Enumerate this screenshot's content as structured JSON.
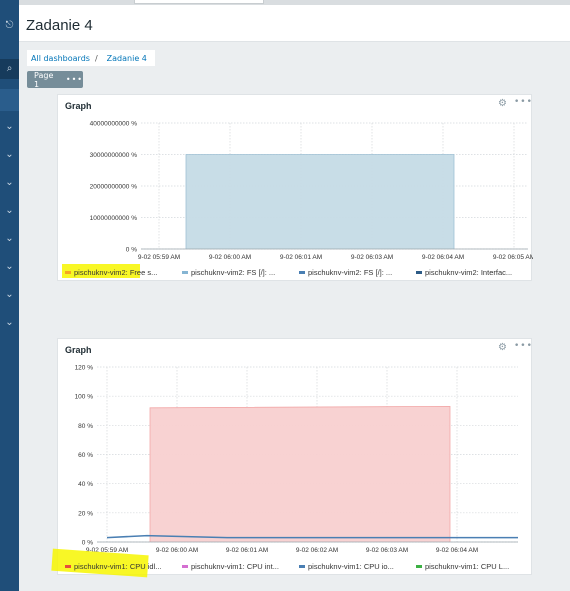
{
  "header": {
    "title": "Zadanie 4"
  },
  "breadcrumb": {
    "root": "All dashboards",
    "separator": "/",
    "current": "Zadanie 4"
  },
  "page_tab": {
    "label": "Page 1",
    "menu": "•••"
  },
  "sidebar": {
    "icons": [
      "logout-icon",
      "search-icon",
      "chevron-down-icon",
      "chevron-down-icon",
      "chevron-down-icon",
      "chevron-down-icon",
      "chevron-down-icon",
      "chevron-down-icon",
      "chevron-down-icon",
      "chevron-down-icon"
    ]
  },
  "highlight_color": "#f7f600",
  "widgets": [
    {
      "title": "Graph",
      "legend": [
        {
          "label": "pischuknv-vim2: Free s...",
          "color": "#f5a623"
        },
        {
          "label": "pischuknv-vim2: FS [/]: ...",
          "color": "#86b5d3"
        },
        {
          "label": "pischuknv-vim2: FS [/]: ...",
          "color": "#4a7fb3"
        },
        {
          "label": "pischuknv-vim2: Interfac...",
          "color": "#2d5b86"
        }
      ]
    },
    {
      "title": "Graph",
      "legend": [
        {
          "label": "pischuknv-vim1: CPU idl...",
          "color": "#e74c3c"
        },
        {
          "label": "pischuknv-vim1: CPU int...",
          "color": "#d46fd1"
        },
        {
          "label": "pischuknv-vim1: CPU io...",
          "color": "#4a7fb3"
        },
        {
          "label": "pischuknv-vim1: CPU L...",
          "color": "#3cb043"
        }
      ]
    }
  ],
  "chart_data": [
    {
      "type": "area",
      "y_ticks": [
        "40000000000 %",
        "30000000000 %",
        "20000000000 %",
        "10000000000 %",
        "0 %"
      ],
      "x_ticks": [
        "9-02 05:59 AM",
        "9-02 06:00 AM",
        "9-02 06:01 AM",
        "9-02 06:03 AM",
        "9-02 06:04 AM",
        "9-02 06:05 AM"
      ],
      "ylim": [
        0,
        40000000000
      ],
      "series": [
        {
          "x": [
            "9-02 06:00 AM",
            "9-02 06:04 AM"
          ],
          "values": [
            30000000000,
            30000000000
          ],
          "color": "#c5dbe6"
        }
      ],
      "grid": true
    },
    {
      "type": "area",
      "y_ticks": [
        "120 %",
        "100 %",
        "80 %",
        "60 %",
        "40 %",
        "20 %",
        "0 %"
      ],
      "x_ticks": [
        "9-02 05:59 AM",
        "9-02 06:00 AM",
        "9-02 06:01 AM",
        "9-02 06:02 AM",
        "9-02 06:03 AM",
        "9-02 06:04 AM"
      ],
      "ylim": [
        0,
        120
      ],
      "series": [
        {
          "x": [
            "9-02 06:00 AM",
            "9-02 06:04 AM"
          ],
          "values": [
            92,
            93
          ],
          "color": "#f8d0d0"
        },
        {
          "x": [
            "9-02 05:59 AM",
            "9-02 06:04 AM"
          ],
          "values": [
            3,
            3
          ],
          "color": "#4a7fb3"
        }
      ],
      "grid": true
    }
  ]
}
